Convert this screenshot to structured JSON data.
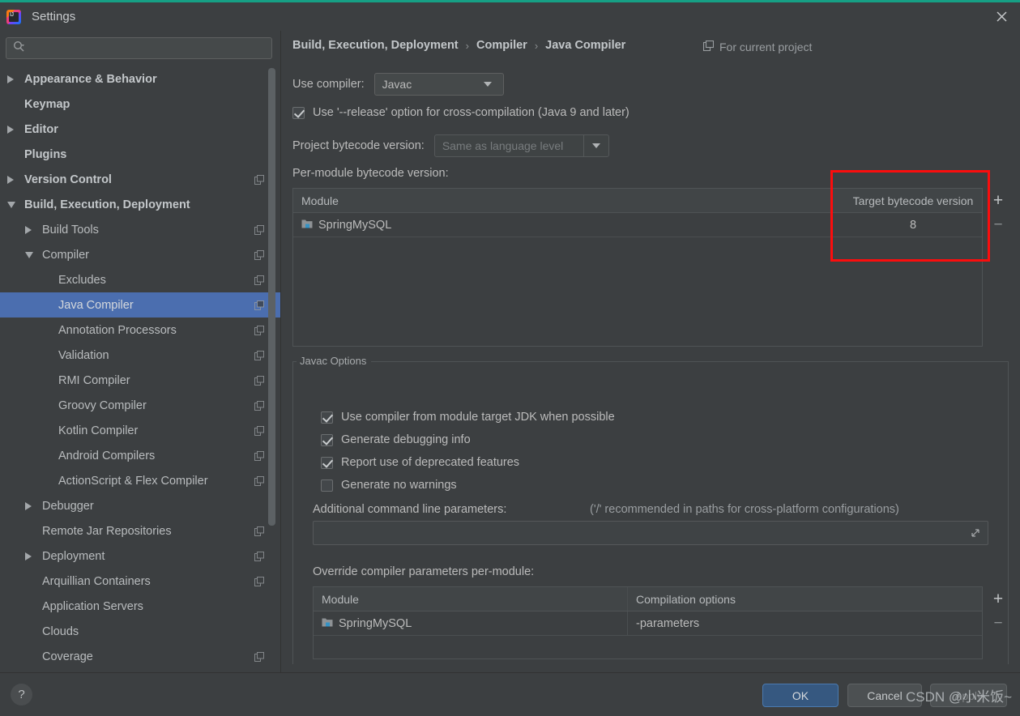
{
  "window": {
    "title": "Settings",
    "app_icon": "intellij-idea-icon",
    "close_icon": "close-icon",
    "accent_color": "#16a085"
  },
  "search": {
    "value": "",
    "placeholder": "",
    "icon": "search-icon"
  },
  "sidebar": {
    "items": [
      {
        "label": "Appearance & Behavior",
        "indent": 0,
        "arrow": "right",
        "bold": true,
        "badge": false,
        "selected": false
      },
      {
        "label": "Keymap",
        "indent": 0,
        "arrow": "none",
        "bold": true,
        "badge": false,
        "selected": false
      },
      {
        "label": "Editor",
        "indent": 0,
        "arrow": "right",
        "bold": true,
        "badge": false,
        "selected": false
      },
      {
        "label": "Plugins",
        "indent": 0,
        "arrow": "none",
        "bold": true,
        "badge": false,
        "selected": false
      },
      {
        "label": "Version Control",
        "indent": 0,
        "arrow": "right",
        "bold": true,
        "badge": true,
        "selected": false
      },
      {
        "label": "Build, Execution, Deployment",
        "indent": 0,
        "arrow": "down",
        "bold": true,
        "badge": false,
        "selected": false
      },
      {
        "label": "Build Tools",
        "indent": 1,
        "arrow": "right",
        "bold": false,
        "badge": true,
        "selected": false
      },
      {
        "label": "Compiler",
        "indent": 1,
        "arrow": "down",
        "bold": false,
        "badge": true,
        "selected": false
      },
      {
        "label": "Excludes",
        "indent": 2,
        "arrow": "none",
        "bold": false,
        "badge": true,
        "selected": false
      },
      {
        "label": "Java Compiler",
        "indent": 2,
        "arrow": "none",
        "bold": false,
        "badge": true,
        "selected": true
      },
      {
        "label": "Annotation Processors",
        "indent": 2,
        "arrow": "none",
        "bold": false,
        "badge": true,
        "selected": false
      },
      {
        "label": "Validation",
        "indent": 2,
        "arrow": "none",
        "bold": false,
        "badge": true,
        "selected": false
      },
      {
        "label": "RMI Compiler",
        "indent": 2,
        "arrow": "none",
        "bold": false,
        "badge": true,
        "selected": false
      },
      {
        "label": "Groovy Compiler",
        "indent": 2,
        "arrow": "none",
        "bold": false,
        "badge": true,
        "selected": false
      },
      {
        "label": "Kotlin Compiler",
        "indent": 2,
        "arrow": "none",
        "bold": false,
        "badge": true,
        "selected": false
      },
      {
        "label": "Android Compilers",
        "indent": 2,
        "arrow": "none",
        "bold": false,
        "badge": true,
        "selected": false
      },
      {
        "label": "ActionScript & Flex Compiler",
        "indent": 2,
        "arrow": "none",
        "bold": false,
        "badge": true,
        "selected": false
      },
      {
        "label": "Debugger",
        "indent": 1,
        "arrow": "right",
        "bold": false,
        "badge": false,
        "selected": false
      },
      {
        "label": "Remote Jar Repositories",
        "indent": 1,
        "arrow": "none",
        "bold": false,
        "badge": true,
        "selected": false
      },
      {
        "label": "Deployment",
        "indent": 1,
        "arrow": "right",
        "bold": false,
        "badge": true,
        "selected": false
      },
      {
        "label": "Arquillian Containers",
        "indent": 1,
        "arrow": "none",
        "bold": false,
        "badge": true,
        "selected": false
      },
      {
        "label": "Application Servers",
        "indent": 1,
        "arrow": "none",
        "bold": false,
        "badge": false,
        "selected": false
      },
      {
        "label": "Clouds",
        "indent": 1,
        "arrow": "none",
        "bold": false,
        "badge": false,
        "selected": false
      },
      {
        "label": "Coverage",
        "indent": 1,
        "arrow": "none",
        "bold": false,
        "badge": true,
        "selected": false
      }
    ],
    "selection_color": "#4b6eaf"
  },
  "main": {
    "breadcrumb": [
      "Build, Execution, Deployment",
      "Compiler",
      "Java Compiler"
    ],
    "breadcrumb_separator": "›",
    "scope_label": "For current project",
    "scope_icon": "copy-scope-icon",
    "use_compiler_label": "Use compiler:",
    "use_compiler_value": "Javac",
    "release_option_label": "Use '--release' option for cross-compilation (Java 9 and later)",
    "release_option_checked": true,
    "project_bytecode_label": "Project bytecode version:",
    "project_bytecode_value": "Same as language level",
    "per_module_label": "Per-module bytecode version:",
    "bytecode_table": {
      "headers": [
        "Module",
        "Target bytecode version"
      ],
      "rows": [
        {
          "module": "SpringMySQL",
          "target": "8"
        }
      ],
      "add_label": "+",
      "remove_label": "−"
    },
    "javac_group_title": "Javac Options",
    "javac_options": [
      {
        "label": "Use compiler from module target JDK when possible",
        "checked": true
      },
      {
        "label": "Generate debugging info",
        "checked": true
      },
      {
        "label": "Report use of deprecated features",
        "checked": true
      },
      {
        "label": "Generate no warnings",
        "checked": false
      }
    ],
    "additional_params_label": "Additional command line parameters:",
    "additional_params_hint": "('/' recommended in paths for cross-platform configurations)",
    "additional_params_value": "",
    "expand_icon": "expand-icon",
    "override_label": "Override compiler parameters per-module:",
    "override_table": {
      "headers": [
        "Module",
        "Compilation options"
      ],
      "rows": [
        {
          "module": "SpringMySQL",
          "options": "-parameters"
        }
      ],
      "add_label": "+",
      "remove_label": "−"
    }
  },
  "annotation": {
    "highlight_color": "#fb0d0d",
    "target": "target-bytecode-version-column"
  },
  "footer": {
    "help_label": "?",
    "ok_label": "OK",
    "cancel_label": "Cancel",
    "apply_label": "Apply",
    "ok_color": "#365880"
  },
  "watermark": {
    "text": "CSDN @小米饭~"
  }
}
